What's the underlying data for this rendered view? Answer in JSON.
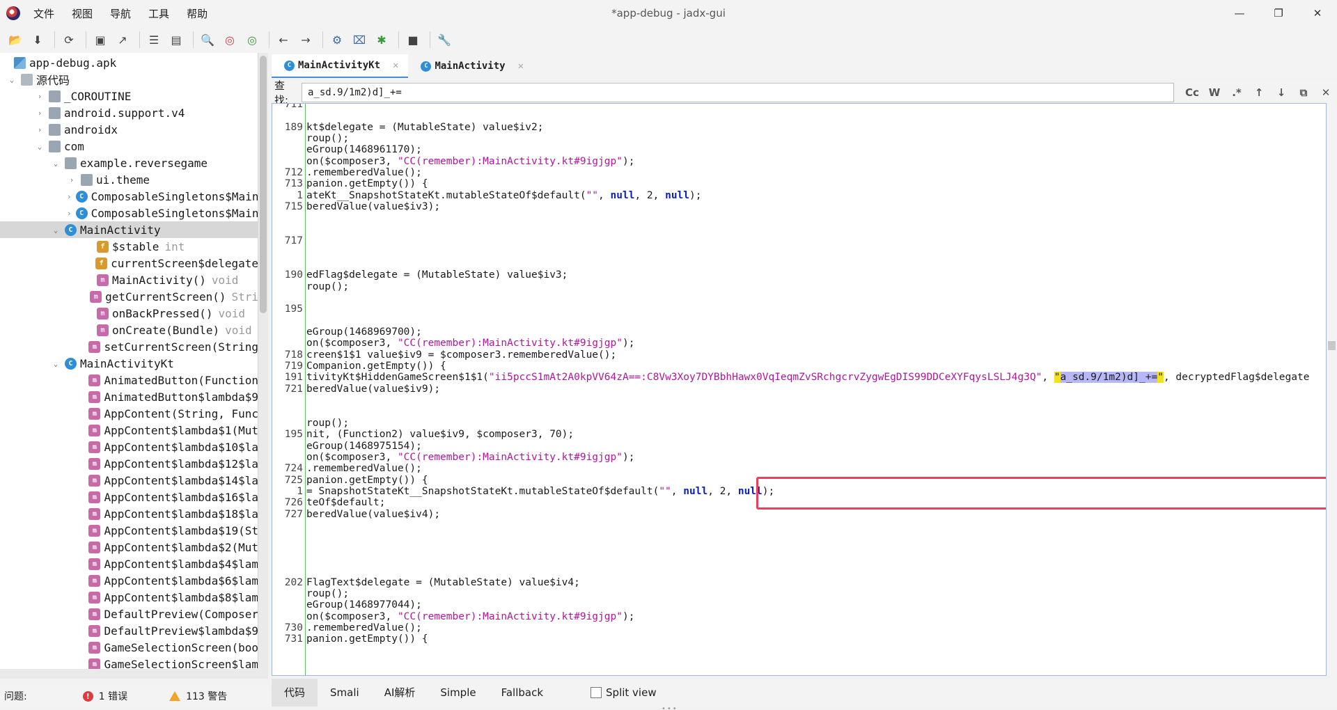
{
  "window": {
    "title": "*app-debug - jadx-gui",
    "menu": [
      "文件",
      "视图",
      "导航",
      "工具",
      "帮助"
    ],
    "controls": [
      "—",
      "❐",
      "✕"
    ]
  },
  "toolbar": [
    "open-icon",
    "save-all-icon",
    "sync-icon",
    "save-icon",
    "export-icon",
    "flatten-icon",
    "pkg-icon",
    "search-icon",
    "find-class-icon",
    "find-usage-icon",
    "back-icon",
    "forward-icon",
    "decompile-icon",
    "deobf-icon",
    "debug-icon",
    "log-icon",
    "prefs-icon"
  ],
  "tree": {
    "rows": [
      {
        "name": "app-debug.apk",
        "icon": "apk",
        "tog": ""
      },
      {
        "name": "源代码",
        "icon": "src",
        "tog": "v"
      },
      {
        "name": "_COROUTINE",
        "icon": "pkg",
        "tog": ">"
      },
      {
        "name": "android.support.v4",
        "icon": "pkg",
        "tog": ">"
      },
      {
        "name": "androidx",
        "icon": "pkg",
        "tog": ">"
      },
      {
        "name": "com",
        "icon": "pkg",
        "tog": "v"
      },
      {
        "name": "example.reversegame",
        "icon": "pkg",
        "tog": "v"
      },
      {
        "name": "ui.theme",
        "icon": "pkg",
        "tog": ">"
      },
      {
        "name": "ComposableSingletons$MainAc",
        "icon": "cls",
        "tog": ">"
      },
      {
        "name": "ComposableSingletons$MainAc",
        "icon": "cls",
        "tog": ">"
      },
      {
        "name": "MainActivity",
        "icon": "cls",
        "tog": "v",
        "selected": true
      },
      {
        "name": "$stable",
        "type": "int",
        "icon": "fld",
        "tog": ""
      },
      {
        "name": "currentScreen$delegate",
        "icon": "fld",
        "tog": ""
      },
      {
        "name": "MainActivity()",
        "type": "void",
        "icon": "mth",
        "tog": ""
      },
      {
        "name": "getCurrentScreen()",
        "type": "Stri",
        "icon": "mth",
        "tog": ""
      },
      {
        "name": "onBackPressed()",
        "type": "void",
        "icon": "mth",
        "tog": ""
      },
      {
        "name": "onCreate(Bundle)",
        "type": "void",
        "icon": "mth",
        "tog": ""
      },
      {
        "name": "setCurrentScreen(String",
        "icon": "mth",
        "tog": ""
      },
      {
        "name": "MainActivityKt",
        "icon": "cls",
        "tog": "v"
      },
      {
        "name": "AnimatedButton(Function",
        "icon": "mth",
        "tog": ""
      },
      {
        "name": "AnimatedButton$lambda$9",
        "icon": "mth",
        "tog": ""
      },
      {
        "name": "AppContent(String, Func",
        "icon": "mth",
        "tog": ""
      },
      {
        "name": "AppContent$lambda$1(Mut",
        "icon": "mth",
        "tog": ""
      },
      {
        "name": "AppContent$lambda$10$la",
        "icon": "mth",
        "tog": ""
      },
      {
        "name": "AppContent$lambda$12$la",
        "icon": "mth",
        "tog": ""
      },
      {
        "name": "AppContent$lambda$14$la",
        "icon": "mth",
        "tog": ""
      },
      {
        "name": "AppContent$lambda$16$la",
        "icon": "mth",
        "tog": ""
      },
      {
        "name": "AppContent$lambda$18$la",
        "icon": "mth",
        "tog": ""
      },
      {
        "name": "AppContent$lambda$19(St",
        "icon": "mth",
        "tog": ""
      },
      {
        "name": "AppContent$lambda$2(Mut",
        "icon": "mth",
        "tog": ""
      },
      {
        "name": "AppContent$lambda$4$lam",
        "icon": "mth",
        "tog": ""
      },
      {
        "name": "AppContent$lambda$6$lam",
        "icon": "mth",
        "tog": ""
      },
      {
        "name": "AppContent$lambda$8$lam",
        "icon": "mth",
        "tog": ""
      },
      {
        "name": "DefaultPreview(Composer",
        "icon": "mth",
        "tog": ""
      },
      {
        "name": "DefaultPreview$lambda$9",
        "icon": "mth",
        "tog": ""
      },
      {
        "name": "GameSelectionScreen(boo",
        "icon": "mth",
        "tog": ""
      },
      {
        "name": "GameSelectionScreen$lam",
        "icon": "mth",
        "tog": ""
      }
    ]
  },
  "tabs": [
    {
      "label": "MainActivityKt",
      "active": true
    },
    {
      "label": "MainActivity",
      "active": false
    }
  ],
  "search": {
    "label": "查找:",
    "value": "a_sd.9/1m2)d]_+=",
    "options": [
      "Cc",
      "W",
      ".*",
      "↑",
      "↓",
      "⧉",
      "✕"
    ]
  },
  "code": [
    {
      "ln": "711",
      "parts": [
        [
          "t",
          ""
        ]
      ]
    },
    {
      "ln": "",
      "parts": [
        [
          "t",
          ""
        ]
      ]
    },
    {
      "ln": "189",
      "parts": [
        [
          "t",
          "kt$delegate = (MutableState) value$iv2;"
        ]
      ]
    },
    {
      "ln": "",
      "parts": [
        [
          "t",
          "roup();"
        ]
      ]
    },
    {
      "ln": "",
      "parts": [
        [
          "t",
          "eGroup(1468961170);"
        ]
      ]
    },
    {
      "ln": "",
      "parts": [
        [
          "t",
          "on($composer3, "
        ],
        [
          "s",
          "\"CC(remember):MainActivity.kt#9igjgp\""
        ],
        [
          "t",
          ");"
        ]
      ]
    },
    {
      "ln": "712",
      "parts": [
        [
          "t",
          ".rememberedValue();"
        ]
      ]
    },
    {
      "ln": "713",
      "parts": [
        [
          "t",
          "panion.getEmpty()) {"
        ]
      ]
    },
    {
      "ln": "1",
      "parts": [
        [
          "t",
          "ateKt__SnapshotStateKt.mutableStateOf$default("
        ],
        [
          "s",
          "\"\""
        ],
        [
          "t",
          ", "
        ],
        [
          "k",
          "null"
        ],
        [
          "t",
          ", 2, "
        ],
        [
          "k",
          "null"
        ],
        [
          "t",
          ");"
        ]
      ]
    },
    {
      "ln": "715",
      "parts": [
        [
          "t",
          "beredValue(value$iv3);"
        ]
      ]
    },
    {
      "ln": "",
      "parts": [
        [
          "t",
          ""
        ]
      ]
    },
    {
      "ln": "",
      "parts": [
        [
          "t",
          ""
        ]
      ]
    },
    {
      "ln": "717",
      "parts": [
        [
          "t",
          ""
        ]
      ]
    },
    {
      "ln": "",
      "parts": [
        [
          "t",
          ""
        ]
      ]
    },
    {
      "ln": "",
      "parts": [
        [
          "t",
          ""
        ]
      ]
    },
    {
      "ln": "190",
      "parts": [
        [
          "t",
          "edFlag$delegate = (MutableState) value$iv3;"
        ]
      ]
    },
    {
      "ln": "",
      "parts": [
        [
          "t",
          "roup();"
        ]
      ]
    },
    {
      "ln": "",
      "parts": [
        [
          "t",
          ""
        ]
      ]
    },
    {
      "ln": "195",
      "parts": [
        [
          "t",
          ""
        ]
      ]
    },
    {
      "ln": "",
      "parts": [
        [
          "t",
          ""
        ]
      ]
    },
    {
      "ln": "",
      "parts": [
        [
          "t",
          "eGroup(1468969700);"
        ]
      ]
    },
    {
      "ln": "",
      "parts": [
        [
          "t",
          "on($composer3, "
        ],
        [
          "s",
          "\"CC(remember):MainActivity.kt#9igjgp\""
        ],
        [
          "t",
          ");"
        ]
      ]
    },
    {
      "ln": "718",
      "parts": [
        [
          "t",
          "creen$1$1 value$iv9 = $composer3.rememberedValue();"
        ]
      ]
    },
    {
      "ln": "719",
      "parts": [
        [
          "t",
          "Companion.getEmpty()) {"
        ]
      ]
    },
    {
      "ln": "191",
      "parts": [
        [
          "t",
          "tivityKt$HiddenGameScreen$1$1("
        ],
        [
          "s",
          "\"ii5pccS1mAt2A0kpVV64zA==:C8Vw3Xoy7DYBbhHawx0VqIeqmZvSRchgcrvZygwEgDIS99DDCeXYFqysLSLJ4g3Q\""
        ],
        [
          "t",
          ", "
        ],
        [
          "hlc",
          "\""
        ],
        [
          "hl",
          "a_sd.9/1m2)d]_+="
        ],
        [
          "hlc",
          "\""
        ],
        [
          "t",
          ", decryptedFlag$delegate"
        ]
      ]
    },
    {
      "ln": "721",
      "parts": [
        [
          "t",
          "beredValue(value$iv9);"
        ]
      ]
    },
    {
      "ln": "",
      "parts": [
        [
          "t",
          ""
        ]
      ]
    },
    {
      "ln": "",
      "parts": [
        [
          "t",
          ""
        ]
      ]
    },
    {
      "ln": "",
      "parts": [
        [
          "t",
          "roup();"
        ]
      ]
    },
    {
      "ln": "195",
      "parts": [
        [
          "t",
          "nit, (Function2) value$iv9, $composer3, 70);"
        ]
      ]
    },
    {
      "ln": "",
      "parts": [
        [
          "t",
          "eGroup(1468975154);"
        ]
      ]
    },
    {
      "ln": "",
      "parts": [
        [
          "t",
          "on($composer3, "
        ],
        [
          "s",
          "\"CC(remember):MainActivity.kt#9igjgp\""
        ],
        [
          "t",
          ");"
        ]
      ]
    },
    {
      "ln": "724",
      "parts": [
        [
          "t",
          ".rememberedValue();"
        ]
      ]
    },
    {
      "ln": "725",
      "parts": [
        [
          "t",
          "panion.getEmpty()) {"
        ]
      ]
    },
    {
      "ln": "1",
      "parts": [
        [
          "t",
          "= SnapshotStateKt__SnapshotStateKt.mutableStateOf$default("
        ],
        [
          "s",
          "\"\""
        ],
        [
          "t",
          ", "
        ],
        [
          "k",
          "null"
        ],
        [
          "t",
          ", 2, "
        ],
        [
          "k",
          "null"
        ],
        [
          "t",
          ");"
        ]
      ]
    },
    {
      "ln": "726",
      "parts": [
        [
          "t",
          "teOf$default;"
        ]
      ]
    },
    {
      "ln": "727",
      "parts": [
        [
          "t",
          "beredValue(value$iv4);"
        ]
      ]
    },
    {
      "ln": "",
      "parts": [
        [
          "t",
          ""
        ]
      ]
    },
    {
      "ln": "",
      "parts": [
        [
          "t",
          ""
        ]
      ]
    },
    {
      "ln": "",
      "parts": [
        [
          "t",
          ""
        ]
      ]
    },
    {
      "ln": "",
      "parts": [
        [
          "t",
          ""
        ]
      ]
    },
    {
      "ln": "",
      "parts": [
        [
          "t",
          ""
        ]
      ]
    },
    {
      "ln": "202",
      "parts": [
        [
          "t",
          "FlagText$delegate = (MutableState) value$iv4;"
        ]
      ]
    },
    {
      "ln": "",
      "parts": [
        [
          "t",
          "roup();"
        ]
      ]
    },
    {
      "ln": "",
      "parts": [
        [
          "t",
          "eGroup(1468977044);"
        ]
      ]
    },
    {
      "ln": "",
      "parts": [
        [
          "t",
          "on($composer3, "
        ],
        [
          "s",
          "\"CC(remember):MainActivity.kt#9igjgp\""
        ],
        [
          "t",
          ");"
        ]
      ]
    },
    {
      "ln": "730",
      "parts": [
        [
          "t",
          ".rememberedValue();"
        ]
      ]
    },
    {
      "ln": "731",
      "parts": [
        [
          "t",
          "panion.getEmpty()) {"
        ]
      ]
    }
  ],
  "viewtabs": [
    "代码",
    "Smali",
    "AI解析",
    "Simple",
    "Fallback"
  ],
  "split_view": "Split view",
  "status": {
    "label": "问题:",
    "errors": "1 错误",
    "warnings": "113 警告"
  }
}
